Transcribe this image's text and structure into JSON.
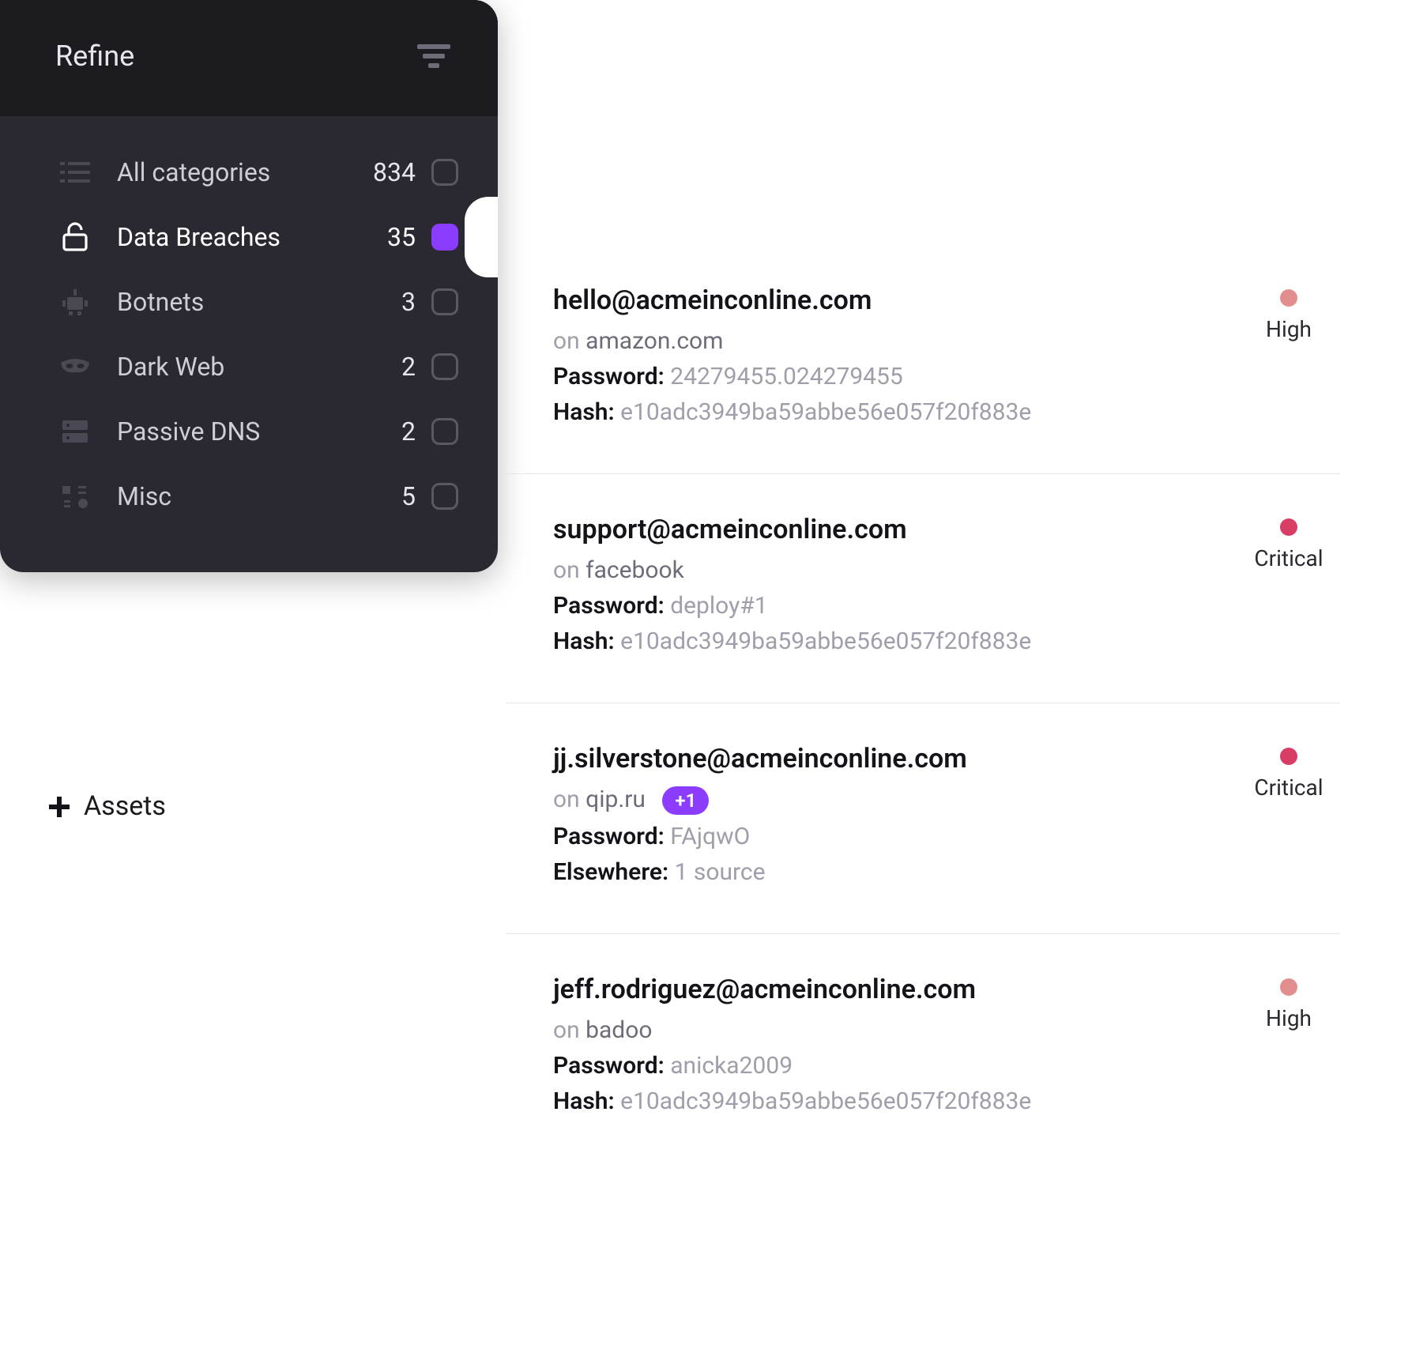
{
  "sidebar": {
    "title": "Refine",
    "categories": [
      {
        "id": "all",
        "label": "All categories",
        "count": "834"
      },
      {
        "id": "breaches",
        "label": "Data Breaches",
        "count": "35",
        "active": true
      },
      {
        "id": "botnets",
        "label": "Botnets",
        "count": "3"
      },
      {
        "id": "darkweb",
        "label": "Dark Web",
        "count": "2"
      },
      {
        "id": "pdns",
        "label": "Passive DNS",
        "count": "2"
      },
      {
        "id": "misc",
        "label": "Misc",
        "count": "5"
      }
    ]
  },
  "assets": {
    "label": "Assets"
  },
  "results": [
    {
      "email": "hello@acmeinconline.com",
      "on_prefix": "on",
      "site": "amazon.com",
      "password_label": "Password:",
      "password": "24279455.024279455",
      "hash_label": "Hash:",
      "hash": "e10adc3949ba59abbe56e057f20f883e",
      "severity": "High",
      "sev_class": "high"
    },
    {
      "email": "support@acmeinconline.com",
      "on_prefix": "on",
      "site": "facebook",
      "password_label": "Password:",
      "password": "deploy#1",
      "hash_label": "Hash:",
      "hash": "e10adc3949ba59abbe56e057f20f883e",
      "severity": "Critical",
      "sev_class": "critical"
    },
    {
      "email": "jj.silverstone@acmeinconline.com",
      "on_prefix": "on",
      "site": "qip.ru",
      "extra_sites_badge": "+1",
      "password_label": "Password:",
      "password": "FAjqwO",
      "elsewhere_label": "Elsewhere:",
      "elsewhere": "1 source",
      "severity": "Critical",
      "sev_class": "critical"
    },
    {
      "email": "jeff.rodriguez@acmeinconline.com",
      "on_prefix": "on",
      "site": "badoo",
      "password_label": "Password:",
      "password": "anicka2009",
      "hash_label": "Hash:",
      "hash": "e10adc3949ba59abbe56e057f20f883e",
      "severity": "High",
      "sev_class": "high"
    }
  ]
}
